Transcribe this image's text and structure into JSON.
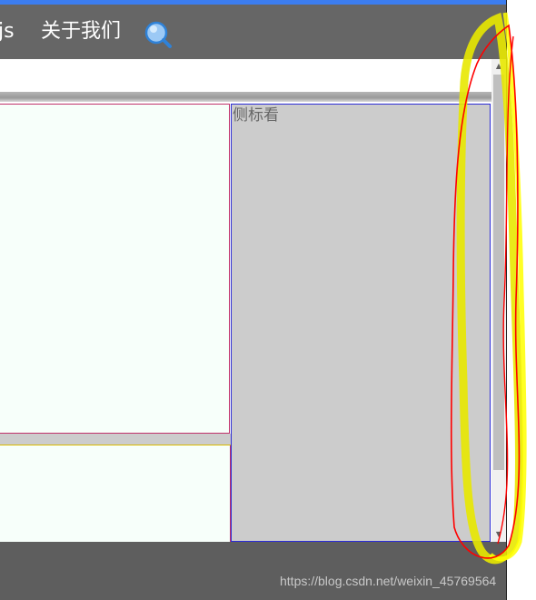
{
  "navbar": {
    "item_js": "js",
    "item_about": "关于我们"
  },
  "sidebar": {
    "title": "侧标看"
  },
  "watermark": "https://blog.csdn.net/weixin_45769564",
  "colors": {
    "navbar_bg": "#666666",
    "top_accent": "#3c7df0",
    "sidebar_bg": "#cccccc",
    "main_bg": "#f7fffa",
    "annotation_yellow": "#ffff00",
    "annotation_red": "#ff0000"
  },
  "icons": {
    "search": "search-icon"
  }
}
